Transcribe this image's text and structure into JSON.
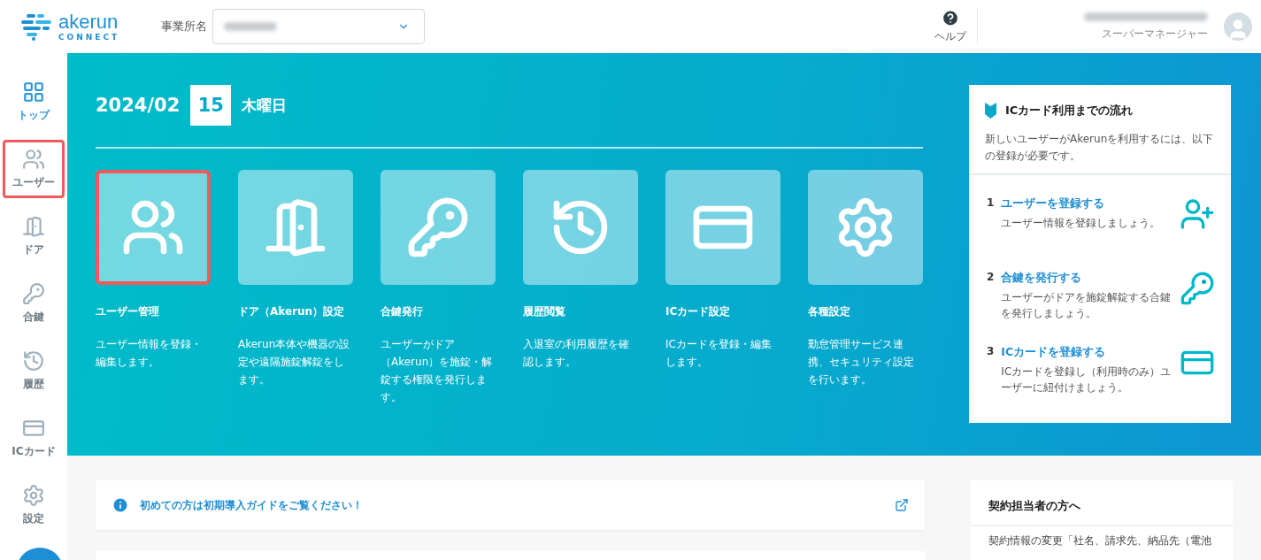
{
  "header": {
    "logo_word": "akerun",
    "logo_sub": "CONNECT",
    "office_label": "事業所名",
    "help_label": "ヘルプ",
    "user_role": "スーパーマネージャー"
  },
  "sidebar": {
    "items": [
      {
        "label": "トップ",
        "kind": "grid",
        "selected": true,
        "highlighted": false
      },
      {
        "label": "ユーザー",
        "kind": "users",
        "selected": false,
        "highlighted": true
      },
      {
        "label": "ドア",
        "kind": "door",
        "selected": false,
        "highlighted": false
      },
      {
        "label": "合鍵",
        "kind": "key",
        "selected": false,
        "highlighted": false
      },
      {
        "label": "履歴",
        "kind": "history",
        "selected": false,
        "highlighted": false
      },
      {
        "label": "ICカード",
        "kind": "card",
        "selected": false,
        "highlighted": false
      },
      {
        "label": "設定",
        "kind": "settings",
        "selected": false,
        "highlighted": false
      }
    ]
  },
  "hero": {
    "year_month": "2024/02",
    "day": "15",
    "weekday": "木曜日",
    "tiles": [
      {
        "title": "ユーザー管理",
        "description": "ユーザー情報を登録・編集します。",
        "kind": "users",
        "highlighted": true
      },
      {
        "title": "ドア（Akerun）設定",
        "description": "Akerun本体や機器の設定や遠隔施錠解錠をします。",
        "kind": "door",
        "highlighted": false
      },
      {
        "title": "合鍵発行",
        "description": "ユーザーがドア（Akerun）を施錠・解錠する権限を発行します。",
        "kind": "key",
        "highlighted": false
      },
      {
        "title": "履歴閲覧",
        "description": "入退室の利用履歴を確認します。",
        "kind": "history",
        "highlighted": false
      },
      {
        "title": "ICカード設定",
        "description": "ICカードを登録・編集します。",
        "kind": "card",
        "highlighted": false
      },
      {
        "title": "各種設定",
        "description": "勤怠管理サービス連携、セキュリティ設定を行います。",
        "kind": "settings",
        "highlighted": false
      }
    ]
  },
  "flow_card": {
    "title": "ICカード利用までの流れ",
    "intro": "新しいユーザーがAkerunを利用するには、以下の登録が必要です。",
    "steps": [
      {
        "number": "1",
        "title": "ユーザーを登録する",
        "description": "ユーザー情報を登録しましょう。",
        "kind": "user-add"
      },
      {
        "number": "2",
        "title": "合鍵を発行する",
        "description": "ユーザーがドアを施錠解錠する合鍵を発行しましょう。",
        "kind": "key"
      },
      {
        "number": "3",
        "title": "ICカードを登録する",
        "description": "ICカードを登録し（利用時のみ）ユーザーに紐付けましょう。",
        "kind": "card"
      }
    ]
  },
  "notice": {
    "text": "初めての方は初期導入ガイドをご覧ください！"
  },
  "contract_card": {
    "title": "契約担当者の方へ",
    "text": "契約情報の変更「社名、請求先、納品先（電池"
  }
}
